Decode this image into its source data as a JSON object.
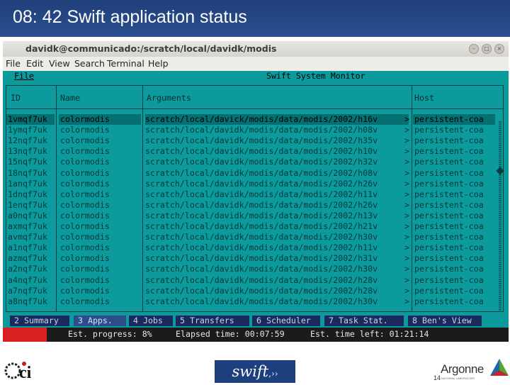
{
  "slide": {
    "title": "08: 42 Swift application status",
    "page_number": "14"
  },
  "window": {
    "title": "davidk@communicado:/scratch/local/davidk/modis",
    "controls": [
      "–",
      "□",
      "×"
    ]
  },
  "menubar": [
    "File",
    "Edit",
    "View",
    "Search",
    "Terminal",
    "Help"
  ],
  "app": {
    "menu": "File",
    "title": "Swift System Monitor",
    "columns": [
      "ID",
      "Name",
      "Arguments",
      "Host"
    ],
    "rows": [
      {
        "id": "1vmqf7uk",
        "name": "colormodis",
        "args": "scratch/local/davick/modis/data/modis/2002/h16v",
        "more": ">",
        "host": "persistent-coa"
      },
      {
        "id": "1ymqf7uk",
        "name": "colormodis",
        "args": "scratch/local/davidk/modis/data/modis/2002/h08v",
        "more": ">",
        "host": "persistent-coa"
      },
      {
        "id": "12nqf7uk",
        "name": "colormodis",
        "args": "scratch/local/davidk/modis/data/modis/2002/h35v",
        "more": ">",
        "host": "persistent-coa"
      },
      {
        "id": "13nqf7uk",
        "name": "colormodis",
        "args": "scratch/local/davidk/modis/data/modis/2002/h10v",
        "more": ">",
        "host": "persistent-coa"
      },
      {
        "id": "15nqf7uk",
        "name": "colormodis",
        "args": "scratch/local/davidk/modis/data/modis/2002/h32v",
        "more": ">",
        "host": "persistent-coa"
      },
      {
        "id": "18nqf7uk",
        "name": "colormodis",
        "args": "scratch/local/davidk/modis/data/modis/2002/h08v",
        "more": ">",
        "host": "persistent-coa"
      },
      {
        "id": "1anqf7uk",
        "name": "colormodis",
        "args": "scratch/local/davidk/modis/data/modis/2002/h26v",
        "more": ">",
        "host": "persistent-coa"
      },
      {
        "id": "1dnqf7uk",
        "name": "colormodis",
        "args": "scratch/local/davidk/modis/data/modis/2002/h11v",
        "more": ">",
        "host": "persistent-coa"
      },
      {
        "id": "1enqf7uk",
        "name": "colormodis",
        "args": "scratch/local/davidk/modis/data/modis/2002/h26v",
        "more": ">",
        "host": "persistent-coa"
      },
      {
        "id": "a0nqf7uk",
        "name": "colormodis",
        "args": "scratch/local/davidk/modis/data/modis/2002/h13v",
        "more": ">",
        "host": "persistent-coa"
      },
      {
        "id": "axmqf7uk",
        "name": "colormodis",
        "args": "scratch/local/davidk/modis/data/modis/2002/h21v",
        "more": ">",
        "host": "persistent-coa"
      },
      {
        "id": "avmqf7uk",
        "name": "colormodis",
        "args": "scratch/local/davidk/modis/data/modis/2002/h30v",
        "more": ">",
        "host": "persistent-coa"
      },
      {
        "id": "a1nqf7uk",
        "name": "colormodis",
        "args": "scratch/local/davidk/modis/data/modis/2002/h11v",
        "more": ">",
        "host": "persistent-coa"
      },
      {
        "id": "azmqf7uk",
        "name": "colormodis",
        "args": "scratch/local/davidk/modis/data/modis/2002/h31v",
        "more": ">",
        "host": "persistent-coa"
      },
      {
        "id": "a2nqf7uk",
        "name": "colormodis",
        "args": "scratch/local/davidk/modis/data/modis/2002/h30v",
        "more": ">",
        "host": "persistent-coa"
      },
      {
        "id": "a4nqf7uk",
        "name": "colormodis",
        "args": "scratch/local/davidk/modis/data/modis/2002/h28v",
        "more": ">",
        "host": "persistent-coa"
      },
      {
        "id": "a7nqf7uk",
        "name": "colormodis",
        "args": "scratch/local/davidk/modis/data/modis/2002/h28v",
        "more": ">",
        "host": "persistent-coa"
      },
      {
        "id": "a8nqf7uk",
        "name": "colormodis",
        "args": "scratch/local/davidk/modis/data/modis/2002/h30v",
        "more": ">",
        "host": "persistent-coa"
      }
    ],
    "selected_row": 0,
    "tabs": [
      {
        "label": "2 Summary",
        "active": false
      },
      {
        "label": "3 Apps.",
        "active": true
      },
      {
        "label": "4 Jobs",
        "active": false
      },
      {
        "label": "5 Transfers",
        "active": false
      },
      {
        "label": "6 Scheduler",
        "active": false
      },
      {
        "label": "7 Task Stat.",
        "active": false
      },
      {
        "label": "8 Ben's View",
        "active": false
      }
    ],
    "status": {
      "progress_label": "Est. progress: 8%",
      "progress_fraction": 0.08,
      "elapsed_label": "Elapsed time: 00:07:59",
      "time_left_label": "Est. time left: 01:21:14"
    }
  },
  "footer": {
    "ci_logo": "ci",
    "swift_logo": "swift",
    "argonne": "Argonne",
    "argonne_sub": "NATIONAL LABORATORY"
  },
  "colors": {
    "slide_title_bg": "#1f3f7a",
    "terminal_bg": "#0d9a9c",
    "selection_bg": "#066f71",
    "tab_bg": "#1a2a5e",
    "progress_red": "#d7201f"
  }
}
